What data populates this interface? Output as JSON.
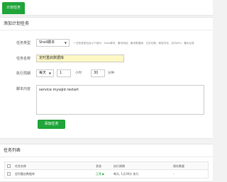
{
  "tabs": {
    "active_label": "计划任务"
  },
  "add_panel": {
    "title": "添加计划任务",
    "task_type": {
      "label": "任务类型",
      "value": "Shell脚本",
      "hint": "* 任务类型包含以下部分：Shell脚本、备份网站、备份数据库、日志切割、释放内存、访问URL、备份目录"
    },
    "task_name": {
      "label": "任务名称",
      "value": "定时重启数据库"
    },
    "period": {
      "label": "执行周期",
      "type_value": "每天",
      "hour": "1",
      "hour_unit": "小时",
      "minute": "30",
      "minute_unit": "分钟"
    },
    "script": {
      "label": "脚本内容",
      "value": "service mysqld restart"
    },
    "submit_label": "添加任务"
  },
  "list_panel": {
    "title": "任务列表",
    "headers": [
      "任务名称",
      "状态",
      "执行周期",
      "保存数量"
    ],
    "rows": [
      {
        "name": "定时重启数据库",
        "status": "正常 ▶",
        "period": "每天, 1点30分 执行",
        "count": "-"
      }
    ]
  }
}
